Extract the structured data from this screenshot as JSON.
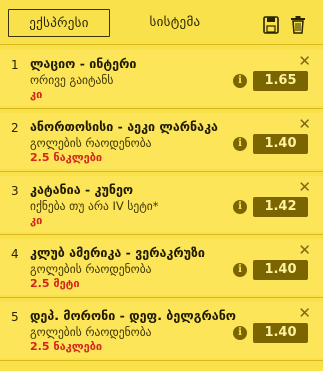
{
  "tabs": {
    "express": "ექსპრესი",
    "system": "სისტემა"
  },
  "bets": [
    {
      "num": "1",
      "match": "ლაციო - ინტერი",
      "market": "ორივე გაიტანს",
      "pick": "კი",
      "odds": "1.65"
    },
    {
      "num": "2",
      "match": "ანორთოსისი - აეკი ლარნაკა",
      "market": "გოლების რაოდენობა",
      "pick": "2.5 ნაკლები",
      "odds": "1.40"
    },
    {
      "num": "3",
      "match": "კატანია - კუნეო",
      "market": "იქნება თუ არა IV სეტი*",
      "pick": "კი",
      "odds": "1.42"
    },
    {
      "num": "4",
      "match": "კლუბ ამერიკა - ვერაკრუზი",
      "market": "გოლების რაოდენობა",
      "pick": "2.5 მეტი",
      "odds": "1.40"
    },
    {
      "num": "5",
      "match": "დეპ. მორონი - დეფ. ბელგრანო",
      "market": "გოლების რაოდენობა",
      "pick": "2.5 ნაკლები",
      "odds": "1.40"
    }
  ],
  "colors": {
    "background": "#f9e14b",
    "odds_button": "#7a6500",
    "pick_text": "#d4261c"
  },
  "icons": {
    "save": "save-icon",
    "trash": "trash-icon",
    "close": "close-icon",
    "info": "info-icon"
  }
}
